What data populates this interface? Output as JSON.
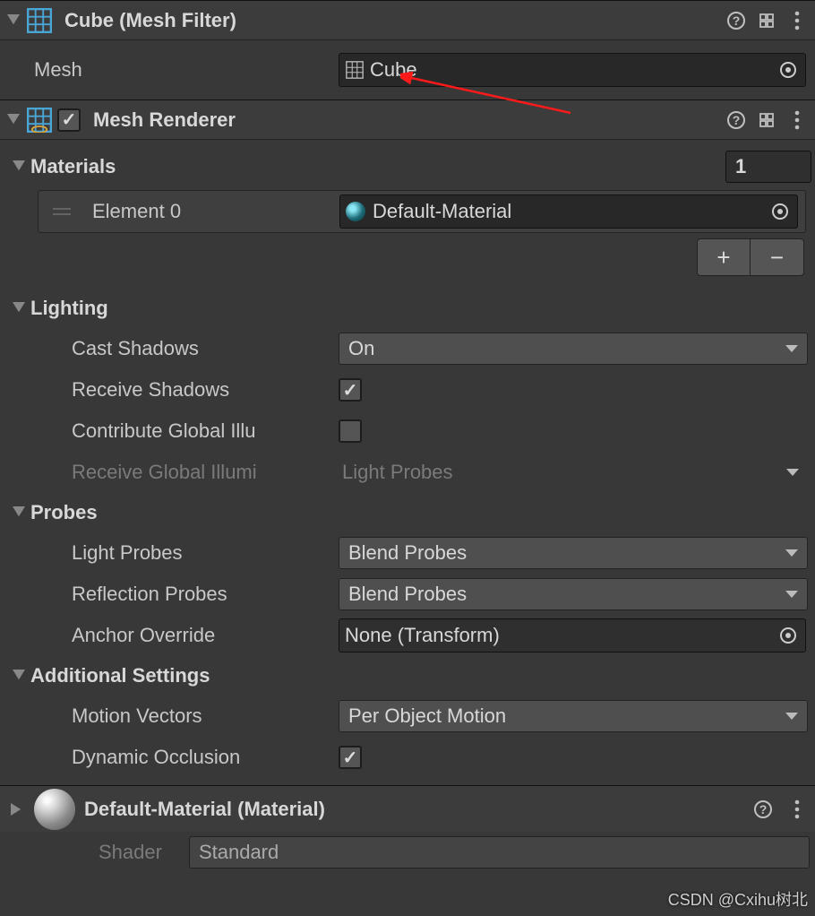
{
  "meshFilter": {
    "title": "Cube (Mesh Filter)",
    "meshLabel": "Mesh",
    "meshValue": "Cube"
  },
  "meshRenderer": {
    "title": "Mesh Renderer",
    "enabled": true,
    "materials": {
      "header": "Materials",
      "size": "1",
      "element0": {
        "label": "Element 0",
        "value": "Default-Material"
      }
    },
    "lighting": {
      "header": "Lighting",
      "castShadows": {
        "label": "Cast Shadows",
        "value": "On"
      },
      "receiveShadows": {
        "label": "Receive Shadows",
        "checked": true
      },
      "contributeGI": {
        "label": "Contribute Global Illu",
        "checked": false
      },
      "receiveGI": {
        "label": "Receive Global Illumi",
        "value": "Light Probes"
      }
    },
    "probes": {
      "header": "Probes",
      "lightProbes": {
        "label": "Light Probes",
        "value": "Blend Probes"
      },
      "reflectionProbes": {
        "label": "Reflection Probes",
        "value": "Blend Probes"
      },
      "anchorOverride": {
        "label": "Anchor Override",
        "value": "None (Transform)"
      }
    },
    "additional": {
      "header": "Additional Settings",
      "motionVectors": {
        "label": "Motion Vectors",
        "value": "Per Object Motion"
      },
      "dynamicOcclusion": {
        "label": "Dynamic Occlusion",
        "checked": true
      }
    }
  },
  "material": {
    "title": "Default-Material (Material)",
    "shaderLabel": "Shader",
    "shaderValue": "Standard"
  },
  "watermark": "CSDN @Cxihu树北"
}
